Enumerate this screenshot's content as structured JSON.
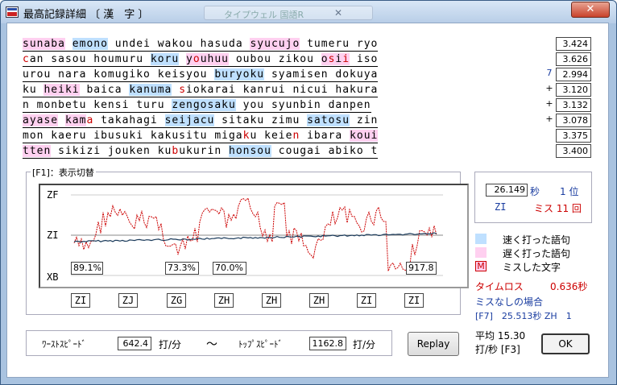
{
  "window": {
    "title": "最高記録詳細 〔 漢　字 〕",
    "ghost_title": "タイプウェル 国語R",
    "ghost_close": "✕",
    "close_glyph": "✕"
  },
  "lines": [
    {
      "segs": [
        {
          "t": "sunaba",
          "k": "s"
        },
        {
          "t": " "
        },
        {
          "t": "emono",
          "k": "f"
        },
        {
          "t": " undei wakou hasuda "
        },
        {
          "t": "syucujo",
          "k": "s"
        },
        {
          "t": " tumeru ryo"
        }
      ]
    },
    {
      "segs": [
        {
          "t": "c",
          "k": "c"
        },
        {
          "t": "an sasou houmuru "
        },
        {
          "t": "koru",
          "k": "f"
        },
        {
          "t": " "
        },
        {
          "t": "y",
          "k": "s"
        },
        {
          "t": "o",
          "k": "sc"
        },
        {
          "t": "uhuu",
          "k": "s"
        },
        {
          "t": " oubou zikou "
        },
        {
          "t": "o",
          "k": "s"
        },
        {
          "t": "s",
          "k": "sc"
        },
        {
          "t": "i",
          "k": "s"
        },
        {
          "t": "i",
          "k": "sc"
        },
        {
          "t": " iso"
        }
      ]
    },
    {
      "segs": [
        {
          "t": "urou nara komugiko keisyou "
        },
        {
          "t": "buryoku",
          "k": "f"
        },
        {
          "t": " syamisen dokuya"
        }
      ]
    },
    {
      "segs": [
        {
          "t": "ku "
        },
        {
          "t": "heiki",
          "k": "s"
        },
        {
          "t": " baica "
        },
        {
          "t": "kanuma",
          "k": "f"
        },
        {
          "t": " "
        },
        {
          "t": "s",
          "k": "c"
        },
        {
          "t": "iokarai kanrui nicui hakura"
        }
      ]
    },
    {
      "segs": [
        {
          "t": "n monbetu kensi turu "
        },
        {
          "t": "zengosaku",
          "k": "f"
        },
        {
          "t": " you syunbin danpen"
        }
      ]
    },
    {
      "segs": [
        {
          "t": "ayase",
          "k": "s"
        },
        {
          "t": " "
        },
        {
          "t": "kam",
          "k": "s"
        },
        {
          "t": "a",
          "k": "c"
        },
        {
          "t": " takahagi "
        },
        {
          "t": "seijacu",
          "k": "f"
        },
        {
          "t": " sitaku zimu "
        },
        {
          "t": "satosu",
          "k": "f"
        },
        {
          "t": " zin"
        }
      ]
    },
    {
      "segs": [
        {
          "t": "mon kaeru ibusuki kakusitu miga"
        },
        {
          "t": "k",
          "k": "c"
        },
        {
          "t": "u keie"
        },
        {
          "t": "n",
          "k": "c"
        },
        {
          "t": " ibara "
        },
        {
          "t": "koui",
          "k": "s"
        }
      ]
    },
    {
      "segs": [
        {
          "t": "tten",
          "k": "s"
        },
        {
          "t": " sikizi jouken ku"
        },
        {
          "t": "b",
          "k": "c"
        },
        {
          "t": "ukurin "
        },
        {
          "t": "honsou",
          "k": "f"
        },
        {
          "t": " cougai abiko t"
        }
      ]
    }
  ],
  "scores": [
    "3.424",
    "3.626",
    "2.994",
    "3.120",
    "3.132",
    "3.078",
    "3.375",
    "3.400"
  ],
  "marks": [
    "",
    "",
    "7",
    "+",
    "+",
    "+",
    "",
    ""
  ],
  "graph": {
    "section_label": "[F1]：表示切替",
    "y_labels": {
      "top": "ZF",
      "mid": "ZI",
      "bottom": "XB"
    },
    "values": [
      "89.1%",
      "73.3%",
      "70.0%",
      "917.8"
    ],
    "z_ranks": [
      "ZI",
      "ZJ",
      "ZG",
      "ZH",
      "ZH",
      "ZH",
      "ZI",
      "ZI"
    ]
  },
  "result": {
    "time": "26.149",
    "time_unit": "秒",
    "rank": "1 位",
    "grade": "ZI",
    "miss": "ミス 11 回"
  },
  "legend": {
    "fast": "速く打った語句",
    "slow": "遅く打った語句",
    "miss_mark": "M",
    "miss": "ミスした文字",
    "fast_color": "#bfe0ff",
    "slow_color": "#ffd0f0"
  },
  "loss": {
    "label": "タイムロス",
    "value": "0.636秒"
  },
  "nomiss": {
    "label": "ミスなしの場合",
    "value": "[F7]　25.513秒 ZH　1"
  },
  "speed": {
    "worst_label": "ﾜｰｽﾄｽﾋﾟｰﾄﾞ",
    "worst": "642.4",
    "unit": "打/分",
    "tilde": "～",
    "top_label": "ﾄｯﾌﾟｽﾋﾟｰﾄﾞ",
    "top": "1162.8",
    "unit2": "打/分"
  },
  "avg": {
    "line1": "平均 15.30",
    "line2": "打/秒 [F3]"
  },
  "buttons": {
    "replay": "Replay",
    "ok": "OK"
  }
}
